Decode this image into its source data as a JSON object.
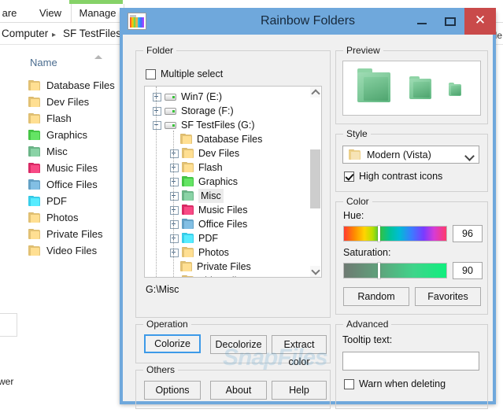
{
  "explorer": {
    "ribbon_tabs": [
      {
        "label": "are"
      },
      {
        "label": "View"
      },
      {
        "label": "Manage"
      }
    ],
    "breadcrumb": {
      "root": "Computer",
      "separator": "▸",
      "current": "SF TestFiles ("
    },
    "right_edge_label": "File",
    "column_header": "Name",
    "files": [
      {
        "name": "Database Files",
        "icon": "folder-icon",
        "color": "#e8c77a"
      },
      {
        "name": "Dev Files",
        "icon": "folder-icon",
        "color": "#e8c77a"
      },
      {
        "name": "Flash",
        "icon": "folder-icon",
        "color": "#e8c77a"
      },
      {
        "name": "Graphics",
        "icon": "folder-icon",
        "color": "#4ccc4c"
      },
      {
        "name": "Misc",
        "icon": "folder-icon",
        "color": "#72bb8e"
      },
      {
        "name": "Music Files",
        "icon": "folder-icon",
        "color": "#e0326d"
      },
      {
        "name": "Office Files",
        "icon": "folder-icon",
        "color": "#6aa7cc"
      },
      {
        "name": "PDF",
        "icon": "folder-icon",
        "color": "#3fd4f0"
      },
      {
        "name": "Photos",
        "icon": "folder-icon",
        "color": "#e8c77a"
      },
      {
        "name": "Private Files",
        "icon": "folder-icon",
        "color": "#e8c77a"
      },
      {
        "name": "Video Files",
        "icon": "folder-icon",
        "color": "#e8c77a"
      }
    ],
    "bottom_text": "wer"
  },
  "dialog": {
    "title": "Rainbow Folders",
    "icon": "rainbow-folder-icon",
    "window_buttons": {
      "minimize": "–",
      "maximize": "□",
      "close": "✕"
    },
    "folder_group": {
      "legend": "Folder",
      "multiple_select": {
        "label": "Multiple select",
        "checked": false
      },
      "tree": [
        {
          "label": "Win7 (E:)",
          "type": "drive",
          "expander": "plus",
          "indent": 0
        },
        {
          "label": "Storage (F:)",
          "type": "drive",
          "expander": "plus",
          "indent": 0
        },
        {
          "label": "SF TestFiles (G:)",
          "type": "drive",
          "expander": "minus",
          "indent": 0
        },
        {
          "label": "Database Files",
          "type": "folder",
          "expander": "none",
          "indent": 1,
          "color": "#e8c77a"
        },
        {
          "label": "Dev Files",
          "type": "folder",
          "expander": "plus",
          "indent": 1,
          "color": "#e8c77a"
        },
        {
          "label": "Flash",
          "type": "folder",
          "expander": "plus",
          "indent": 1,
          "color": "#e8c77a"
        },
        {
          "label": "Graphics",
          "type": "folder",
          "expander": "plus",
          "indent": 1,
          "color": "#4ccc4c"
        },
        {
          "label": "Misc",
          "type": "folder",
          "expander": "plus",
          "indent": 1,
          "color": "#72bb8e",
          "selected": true
        },
        {
          "label": "Music Files",
          "type": "folder",
          "expander": "plus",
          "indent": 1,
          "color": "#e0326d"
        },
        {
          "label": "Office Files",
          "type": "folder",
          "expander": "plus",
          "indent": 1,
          "color": "#6aa7cc"
        },
        {
          "label": "PDF",
          "type": "folder",
          "expander": "plus",
          "indent": 1,
          "color": "#3fd4f0"
        },
        {
          "label": "Photos",
          "type": "folder",
          "expander": "plus",
          "indent": 1,
          "color": "#e8c77a"
        },
        {
          "label": "Private Files",
          "type": "folder",
          "expander": "none",
          "indent": 1,
          "color": "#e8c77a"
        },
        {
          "label": "Video Files",
          "type": "folder",
          "expander": "plus",
          "indent": 1,
          "color": "#e8c77a"
        }
      ],
      "selected_path": "G:\\Misc"
    },
    "operation_group": {
      "legend": "Operation",
      "colorize": "Colorize",
      "decolorize": "Decolorize",
      "extract_color": "Extract color"
    },
    "others_group": {
      "legend": "Others",
      "options": "Options",
      "about": "About",
      "help": "Help"
    },
    "preview_group": {
      "legend": "Preview",
      "folder_color": "#6cc18c"
    },
    "style_group": {
      "legend": "Style",
      "selected_style": "Modern (Vista)",
      "high_contrast": {
        "label": "High contrast icons",
        "checked": true
      }
    },
    "color_group": {
      "legend": "Color",
      "hue_label": "Hue:",
      "hue_value": "96",
      "hue_percent": 33,
      "saturation_label": "Saturation:",
      "saturation_value": "90",
      "saturation_percent": 33,
      "random": "Random",
      "favorites": "Favorites"
    },
    "advanced_group": {
      "legend": "Advanced",
      "tooltip_label": "Tooltip text:",
      "tooltip_value": "",
      "warn_when_deleting": {
        "label": "Warn when deleting",
        "checked": false
      }
    }
  },
  "watermark": {
    "text": "SnapFiles",
    "text2": "s"
  }
}
